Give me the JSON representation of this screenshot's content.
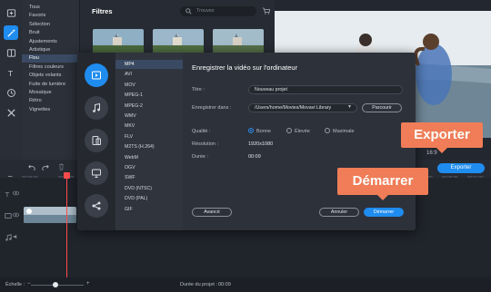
{
  "sidebar_categories": [
    "Tous",
    "Favoris",
    "Sélection",
    "Bruit",
    "Ajustements",
    "Artistique",
    "Flou",
    "Filtres couleurs",
    "Objets volants",
    "Fuite de lumière",
    "Mosaïque",
    "Rétro",
    "Vignettes"
  ],
  "selected_category_index": 6,
  "filters": {
    "title": "Filtres",
    "search_placeholder": "Trouvez"
  },
  "formats": [
    "MP4",
    "AVI",
    "MOV",
    "MPEG-1",
    "MPEG-2",
    "WMV",
    "MKV",
    "FLV",
    "M2TS (H.264)",
    "WebM",
    "OGV",
    "SWF",
    "DVD (NTSC)",
    "DVD (PAL)",
    "GIF"
  ],
  "selected_format_index": 0,
  "export_dialog": {
    "title": "Enregistrer la vidéo sur l'ordinateur",
    "title_label": "Titre :",
    "title_value": "Nouveau projet",
    "save_in_label": "Enregistrer dans :",
    "save_in_value": "/Users/home/Movies/Movavi Library",
    "browse_label": "Parcourir",
    "quality_label": "Qualité :",
    "quality_options": [
      "Bonne",
      "Élevée",
      "Maximale"
    ],
    "quality_selected": "Bonne",
    "resolution_label": "Résolution :",
    "resolution_value": "1920x1080",
    "duration_label": "Durée :",
    "duration_value": "00:09",
    "advanced_label": "Avancé",
    "cancel_label": "Annuler",
    "start_label": "Démarrer"
  },
  "preview": {
    "ratio": "16:9",
    "export_label": "Exporter"
  },
  "timeline": {
    "ruler_ticks": [
      "00:00:00",
      "00:00:05",
      "00:00:10",
      "00:00:15",
      "00:00:20",
      "00:00:25"
    ],
    "ruler_ticks_right": [
      "00:00:50",
      "00:00:55",
      "00:01:00"
    ]
  },
  "callouts": {
    "exporter": "Exporter",
    "demarrer": "Démarrer"
  },
  "status": {
    "scale_label": "Échelle :",
    "duration_label": "Durée du projet :",
    "duration_value": "00:09"
  },
  "colors": {
    "accent": "#1f8cf0",
    "callout": "#f07d57",
    "selection": "#3a4a63"
  }
}
